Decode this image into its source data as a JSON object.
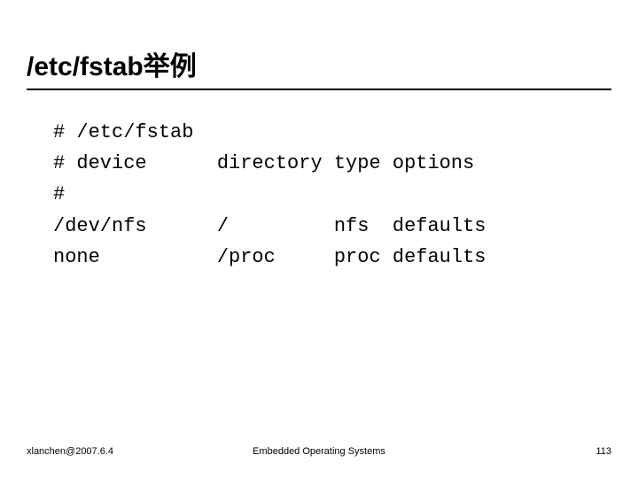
{
  "title": "/etc/fstab举例",
  "code": {
    "line1": "# /etc/fstab",
    "line2": "# device      directory type options",
    "line3": "#",
    "line4": "/dev/nfs      /         nfs  defaults",
    "line5": "none          /proc     proc defaults"
  },
  "footer": {
    "left": "xlanchen@2007.6.4",
    "center": "Embedded Operating Systems",
    "right": "113"
  }
}
